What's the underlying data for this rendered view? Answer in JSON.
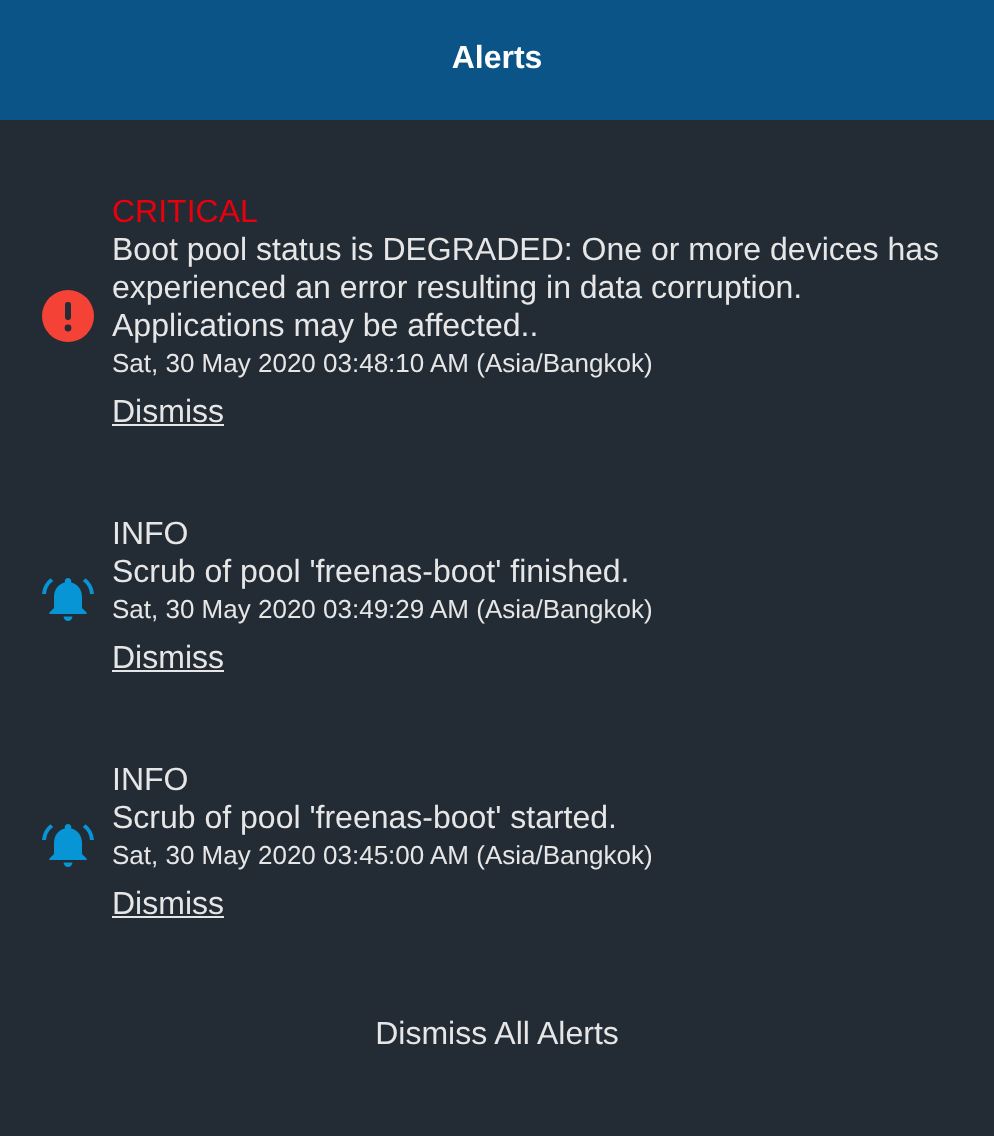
{
  "header": {
    "title": "Alerts"
  },
  "alerts": [
    {
      "kind": "critical",
      "level_label": "CRITICAL",
      "message": "Boot pool status is DEGRADED: One or more devices has experienced an error resulting in data corruption. Applications may be affected..",
      "datetime": "Sat, 30 May 2020 03:48:10 AM (Asia/Bangkok)",
      "action": "Dismiss"
    },
    {
      "kind": "info",
      "level_label": "INFO",
      "message": "Scrub of pool 'freenas-boot' finished.",
      "datetime": "Sat, 30 May 2020 03:49:29 AM (Asia/Bangkok)",
      "action": "Dismiss"
    },
    {
      "kind": "info",
      "level_label": "INFO",
      "message": "Scrub of pool 'freenas-boot' started.",
      "datetime": "Sat, 30 May 2020 03:45:00 AM (Asia/Bangkok)",
      "action": "Dismiss"
    }
  ],
  "footer": {
    "button": "Dismiss All Alerts"
  }
}
